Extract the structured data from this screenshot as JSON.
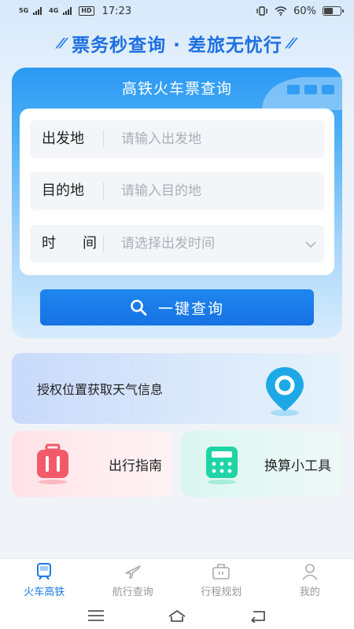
{
  "status": {
    "network_top": "5G",
    "network_top2": "4G",
    "hd": "HD",
    "time": "17:23",
    "battery": "60%",
    "battery_level": 0.6
  },
  "slogan": "票务秒查询 · 差旅无忧行",
  "query": {
    "title": "高铁火车票查询",
    "rows": [
      {
        "label": "出发地",
        "placeholder": "请输入出发地"
      },
      {
        "label": "目的地",
        "placeholder": "请输入目的地"
      },
      {
        "label_a": "时",
        "label_b": "间",
        "placeholder": "请选择出发时间"
      }
    ],
    "button": "一键查询"
  },
  "weather": {
    "text": "授权位置获取天气信息"
  },
  "tools": {
    "guide": "出行指南",
    "calc": "换算小工具"
  },
  "tabs": [
    {
      "label": "火车高铁",
      "active": true
    },
    {
      "label": "航行查询",
      "active": false
    },
    {
      "label": "行程规划",
      "active": false
    },
    {
      "label": "我的",
      "active": false
    }
  ],
  "colors": {
    "accent": "#1a7ae8",
    "card_top": "#2a98f3",
    "guide_icon": "#f25a6a",
    "calc_icon": "#1fd5a5"
  }
}
